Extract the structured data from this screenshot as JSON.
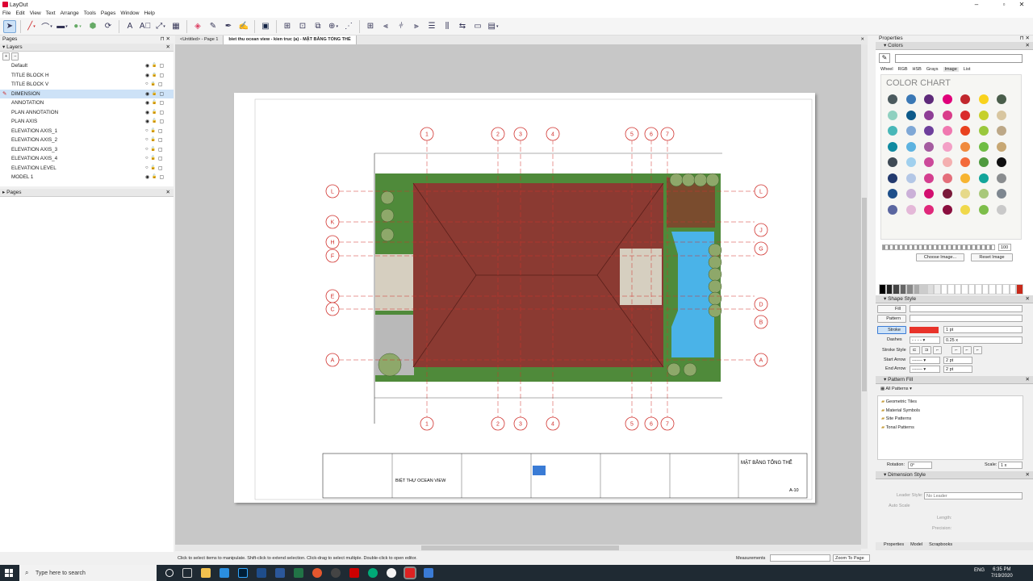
{
  "window": {
    "title": "LayOut"
  },
  "menu": [
    "File",
    "Edit",
    "View",
    "Text",
    "Arrange",
    "Tools",
    "Pages",
    "Window",
    "Help"
  ],
  "left": {
    "pages_title": "Pages",
    "layers_title": "Layers",
    "layers": [
      {
        "name": "Default",
        "visible": true,
        "locked": false
      },
      {
        "name": "TITLE BLOCK H",
        "visible": true,
        "locked": true
      },
      {
        "name": "TITLE BLOCK V",
        "visible": false,
        "locked": true
      },
      {
        "name": "DIMENSION",
        "visible": true,
        "locked": false,
        "selected": true
      },
      {
        "name": "ANNOTATION",
        "visible": true,
        "locked": false
      },
      {
        "name": "PLAN ANNOTATION",
        "visible": true,
        "locked": false
      },
      {
        "name": "PLAN AXIS",
        "visible": true,
        "locked": false
      },
      {
        "name": "ELEVATION AXIS_1",
        "visible": false,
        "locked": false
      },
      {
        "name": "ELEVATION AXIS_2",
        "visible": false,
        "locked": false
      },
      {
        "name": "ELEVATION AXIS_3",
        "visible": false,
        "locked": false
      },
      {
        "name": "ELEVATION AXIS_4",
        "visible": false,
        "locked": false
      },
      {
        "name": "ELEVATION LEVEL",
        "visible": false,
        "locked": false
      },
      {
        "name": "MODEL 1",
        "visible": true,
        "locked": false
      }
    ],
    "pages_bottom_title": "Pages"
  },
  "tabs": [
    "<Untitled> - Page 1",
    "biet thu ocean view - kien truc (a) - MẶT BẰNG TỔNG THỂ"
  ],
  "drawing": {
    "axis_top": [
      "1",
      "2",
      "3",
      "4",
      "5",
      "6",
      "7"
    ],
    "axis_left": [
      "L",
      "K",
      "H",
      "F",
      "E",
      "C",
      "A"
    ],
    "axis_right": [
      "L",
      "J",
      "G",
      "D",
      "B",
      "A"
    ],
    "title_block": {
      "project": "BIỆT THỰ OCEAN VIEW",
      "sheet_title": "MẶT BẰNG TỔNG THỂ",
      "sheet_no": "A-10"
    }
  },
  "right": {
    "properties": "Properties",
    "colors": "Colors",
    "color_tabs": [
      "Wheel",
      "RGB",
      "HSB",
      "Grays",
      "Image",
      "List"
    ],
    "color_chart": "COLOR CHART",
    "opacity": "100",
    "choose_image": "Choose Image...",
    "reset_image": "Reset Image",
    "shape_style": "Shape Style",
    "fill": "Fill",
    "pattern": "Pattern",
    "stroke": "Stroke",
    "stroke_width": "1 pt",
    "dashes": "Dashes",
    "dash_scale": "0.25 x",
    "stroke_style": "Stroke Style",
    "start_arrow": "Start Arrow",
    "end_arrow": "End Arrow",
    "arrow_size": "2 pt",
    "pattern_fill": "Pattern Fill",
    "all_patterns": "All Patterns",
    "patterns": [
      "Geometric Tiles",
      "Material Symbols",
      "Site Patterns",
      "Tonal Patterns"
    ],
    "rotation_label": "Rotation:",
    "rotation": "0°",
    "scale_label": "Scale:",
    "scale": "1 x",
    "dimension_style": "Dimension Style",
    "leader_style": "Leader Style:",
    "leader_value": "No Leader",
    "auto_scale": "Auto Scale",
    "length": "Length:",
    "precision": "Precision:",
    "bottom_tabs": [
      "Properties",
      "Model",
      "Scrapbooks"
    ]
  },
  "status": {
    "hint": "Click to select items to manipulate. Shift-click to extend selection. Click-drag to select multiple. Double-click to open editor.",
    "measurements": "Measurements",
    "zoom": "Zoom To Page"
  },
  "taskbar": {
    "search": "Type here to search",
    "time": "6:35 PM",
    "date": "7/19/2020",
    "lang": "ENG"
  },
  "colors": {
    "accent": "#cde2f7",
    "stroke": "#e8332a",
    "roof": "#8b3a32",
    "grass": "#4f8a3a",
    "pool": "#4ab3e8",
    "axis": "#d0312d"
  }
}
